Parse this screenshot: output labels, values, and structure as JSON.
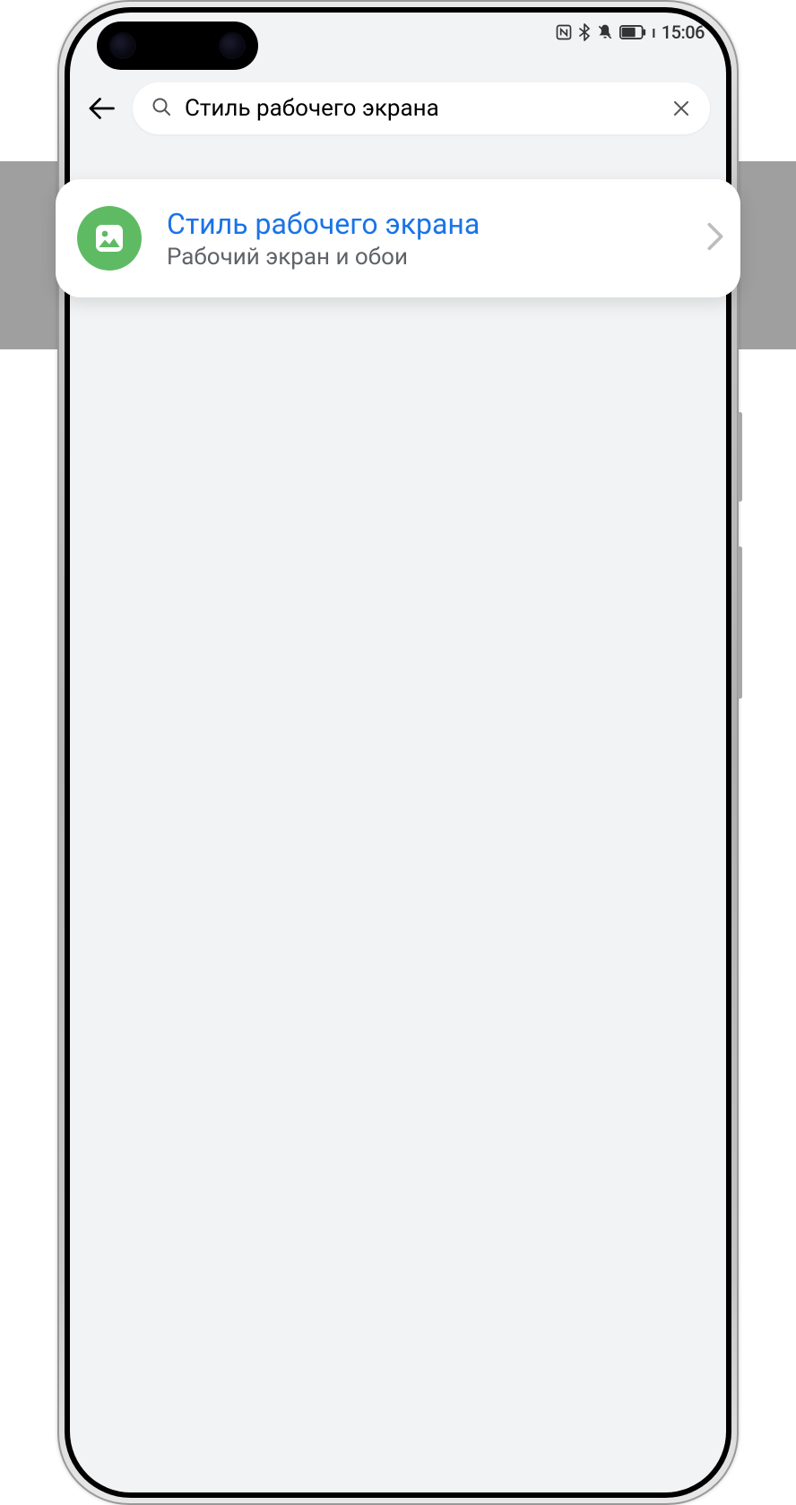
{
  "status_bar": {
    "time": "15:06"
  },
  "search": {
    "value": "Стиль рабочего экрана"
  },
  "result": {
    "title": "Стиль рабочего экрана",
    "subtitle": "Рабочий экран и обои"
  }
}
